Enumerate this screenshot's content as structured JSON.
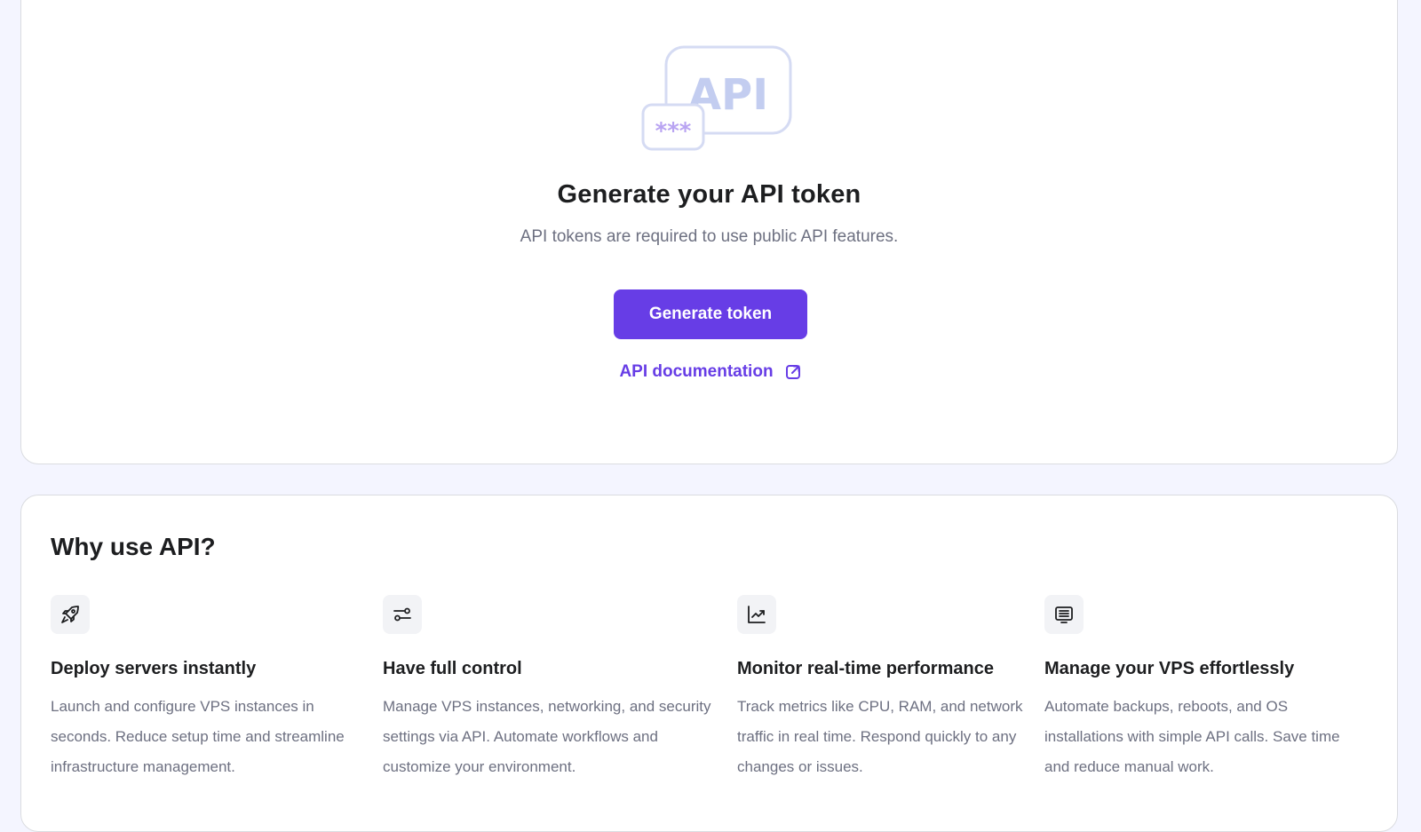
{
  "hero": {
    "illustration_label": "API",
    "illustration_mask": "***",
    "title": "Generate your API token",
    "subtitle": "API tokens are required to use public API features.",
    "generate_button": "Generate token",
    "docs_link": "API documentation"
  },
  "why": {
    "title": "Why use API?",
    "features": [
      {
        "icon": "rocket-icon",
        "title": "Deploy servers instantly",
        "description": "Launch and configure VPS instances in seconds. Reduce setup time and streamline infrastructure management."
      },
      {
        "icon": "sliders-icon",
        "title": "Have full control",
        "description": "Manage VPS instances, networking, and security settings via API. Automate workflows and customize your environment."
      },
      {
        "icon": "chart-line-icon",
        "title": "Monitor real-time performance",
        "description": "Track metrics like CPU, RAM, and network traffic in real time. Respond quickly to any changes or issues."
      },
      {
        "icon": "server-list-icon",
        "title": "Manage your VPS effortlessly",
        "description": "Automate backups, reboots, and OS installations with simple API calls. Save time and reduce manual work."
      }
    ]
  },
  "colors": {
    "accent": "#673de6",
    "background": "#f4f5ff",
    "text_primary": "#1d1e20",
    "text_secondary": "#6d7081"
  }
}
